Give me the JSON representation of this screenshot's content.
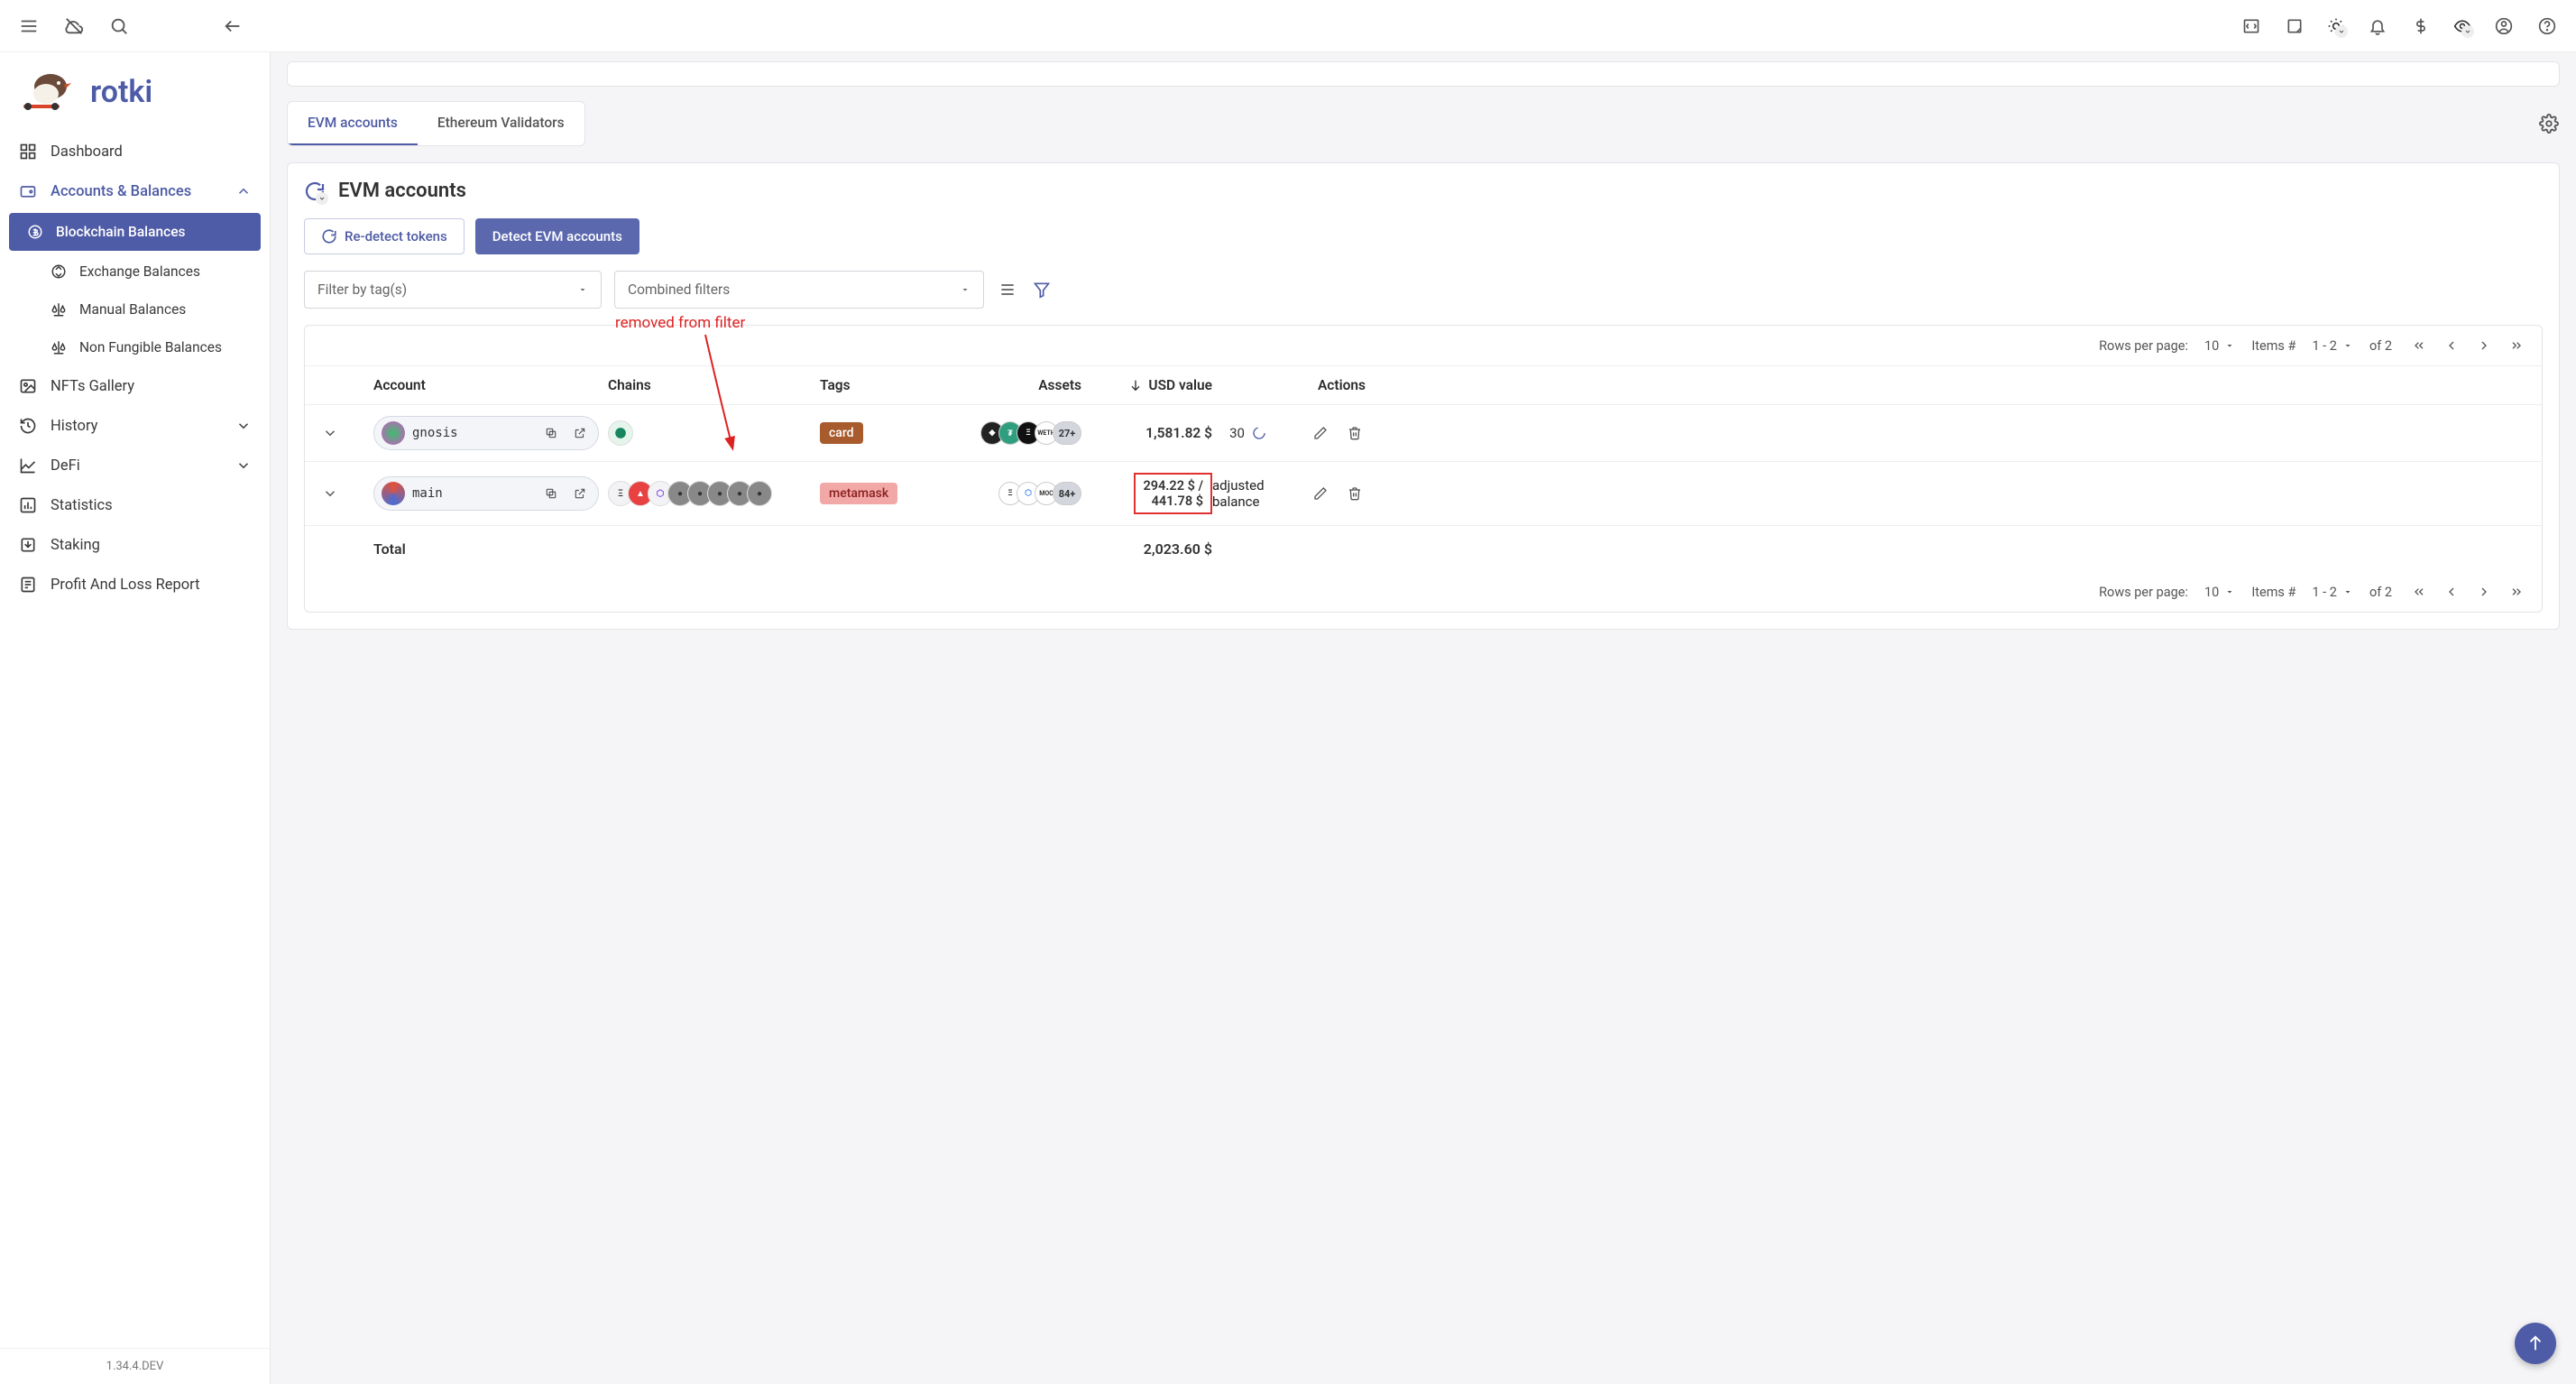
{
  "app": {
    "name": "rotki",
    "version": "1.34.4.DEV"
  },
  "sidebar": {
    "items": [
      {
        "label": "Dashboard",
        "icon": "dashboard"
      },
      {
        "label": "Accounts & Balances",
        "icon": "wallet",
        "active_section": true
      },
      {
        "label": "NFTs Gallery",
        "icon": "image"
      },
      {
        "label": "History",
        "icon": "history",
        "expandable": true
      },
      {
        "label": "DeFi",
        "icon": "chart-line",
        "expandable": true
      },
      {
        "label": "Statistics",
        "icon": "bar-chart"
      },
      {
        "label": "Staking",
        "icon": "download-box"
      },
      {
        "label": "Profit And Loss Report",
        "icon": "report"
      }
    ],
    "subitems": [
      {
        "label": "Blockchain Balances",
        "active": true,
        "icon": "coin"
      },
      {
        "label": "Exchange Balances",
        "icon": "swap"
      },
      {
        "label": "Manual Balances",
        "icon": "scale"
      },
      {
        "label": "Non Fungible Balances",
        "icon": "scale"
      }
    ]
  },
  "tabs": {
    "items": [
      {
        "label": "EVM accounts",
        "active": true
      },
      {
        "label": "Ethereum Validators"
      }
    ]
  },
  "section": {
    "title": "EVM accounts"
  },
  "buttons": {
    "redetect": "Re-detect tokens",
    "detect": "Detect EVM accounts"
  },
  "filters": {
    "tag_placeholder": "Filter by tag(s)",
    "combined_placeholder": "Combined filters"
  },
  "pagination": {
    "rows_label": "Rows per page:",
    "rows_value": "10",
    "items_label": "Items #",
    "range": "1 - 2",
    "of_label": "of 2"
  },
  "table": {
    "headers": {
      "account": "Account",
      "chains": "Chains",
      "tags": "Tags",
      "assets": "Assets",
      "usd": "USD value",
      "actions": "Actions"
    },
    "rows": [
      {
        "name": "gnosis",
        "avatar_color": "#3bbf6b",
        "chains": [
          "gnosis"
        ],
        "tag": {
          "text": "card",
          "class": "tag-card"
        },
        "assets_more": "27+",
        "assets_icons": [
          "A",
          "B",
          "C",
          "D"
        ],
        "usd": "1,581.82 $",
        "usd_secondary": "30"
      },
      {
        "name": "main",
        "avatar_color": "#e2513b",
        "chains": [
          "eth",
          "ava",
          "poly",
          "op",
          "arb",
          "gno",
          "g2",
          "g3"
        ],
        "tag": {
          "text": "metamask",
          "class": "tag-meta"
        },
        "assets_more": "84+",
        "assets_icons": [
          "A",
          "B",
          "C",
          "D"
        ],
        "usd_adjusted_top": "294.22 $ /",
        "usd_adjusted_bottom": "441.78 $",
        "adj_label": "adjusted balance"
      }
    ],
    "total_label": "Total",
    "total_value": "2,023.60 $"
  },
  "annotation": {
    "text": "removed from filter"
  }
}
